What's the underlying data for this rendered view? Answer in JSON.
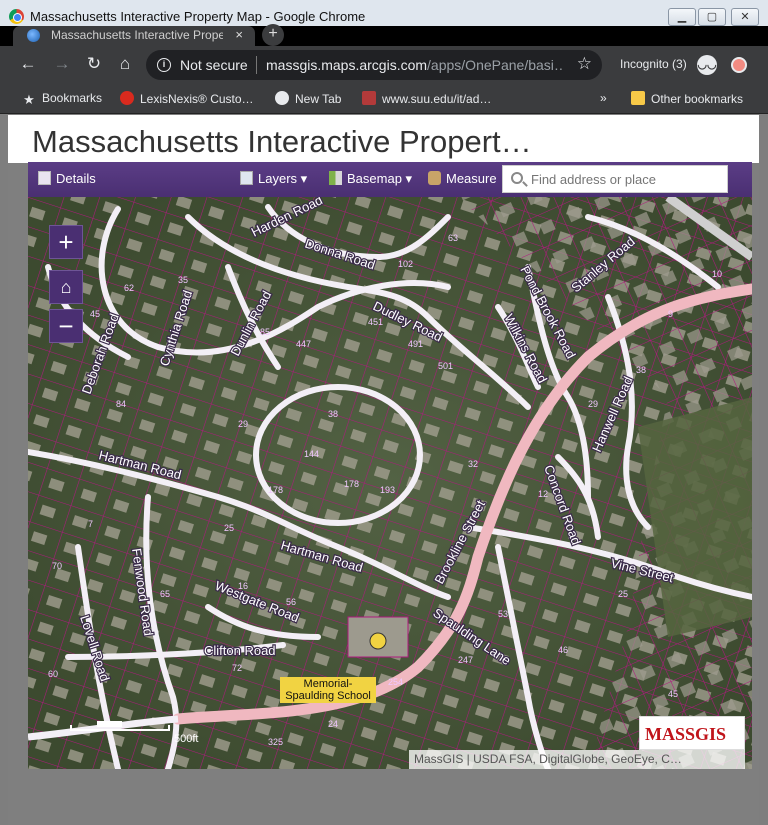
{
  "window": {
    "title": "Massachusetts Interactive Property Map - Google Chrome",
    "minimize_icon": "minimize-icon",
    "maximize_icon": "maximize-icon",
    "close_icon": "close-icon"
  },
  "tab": {
    "title": "Massachusetts Interactive Proper",
    "close": "×",
    "new_tab": "+"
  },
  "nav": {
    "security_label": "Not secure",
    "url_host": "massgis.maps.arcgis.com",
    "url_path": "/apps/OnePane/basi…",
    "incognito_label": "Incognito (3)"
  },
  "bookmarks": {
    "items": [
      {
        "label": "Bookmarks",
        "icon": "star-icon"
      },
      {
        "label": "LexisNexis® Custo…",
        "icon": "lexisnexis-icon"
      },
      {
        "label": "New Tab",
        "icon": "globe-icon"
      },
      {
        "label": "www.suu.edu/it/ad…",
        "icon": "suu-icon"
      }
    ],
    "overflow": "»",
    "other": "Other bookmarks"
  },
  "page": {
    "title": "Massachusetts Interactive Propert…"
  },
  "toolbar": {
    "details": "Details",
    "layers": "Layers",
    "basemap": "Basemap",
    "measure": "Measure",
    "search_placeholder": "Find address or place"
  },
  "map": {
    "zoom_in": "+",
    "zoom_out": "−",
    "home_icon": "home-icon",
    "roads": [
      "Brookline Street",
      "Hartman Road",
      "Hartman Road",
      "Dudley Road",
      "Dunlin Road",
      "Cynthia Road",
      "Deborah Road",
      "Donna Road",
      "Harden Road",
      "Westgate Road",
      "Clifton Road",
      "Fenwood Road",
      "Lovell Road",
      "Vine Street",
      "Spaulding Lane",
      "Pond Brook Road",
      "Wilkins Road",
      "Hanwell Road",
      "Concord Road",
      "Stanley Road"
    ],
    "school_name": "Memorial-Spaulding School",
    "credits": "MassGIS | USDA FSA, DigitalGlobe, GeoEye, C…",
    "logo": "MASSGIS",
    "scale_label": "500ft"
  },
  "colors": {
    "toolbar": "#4a2f72",
    "parcel_lines": "#b0187f",
    "major_road": "#f0b8c0",
    "residential_road": "#f3eff6",
    "logo_red": "#c0141a"
  }
}
